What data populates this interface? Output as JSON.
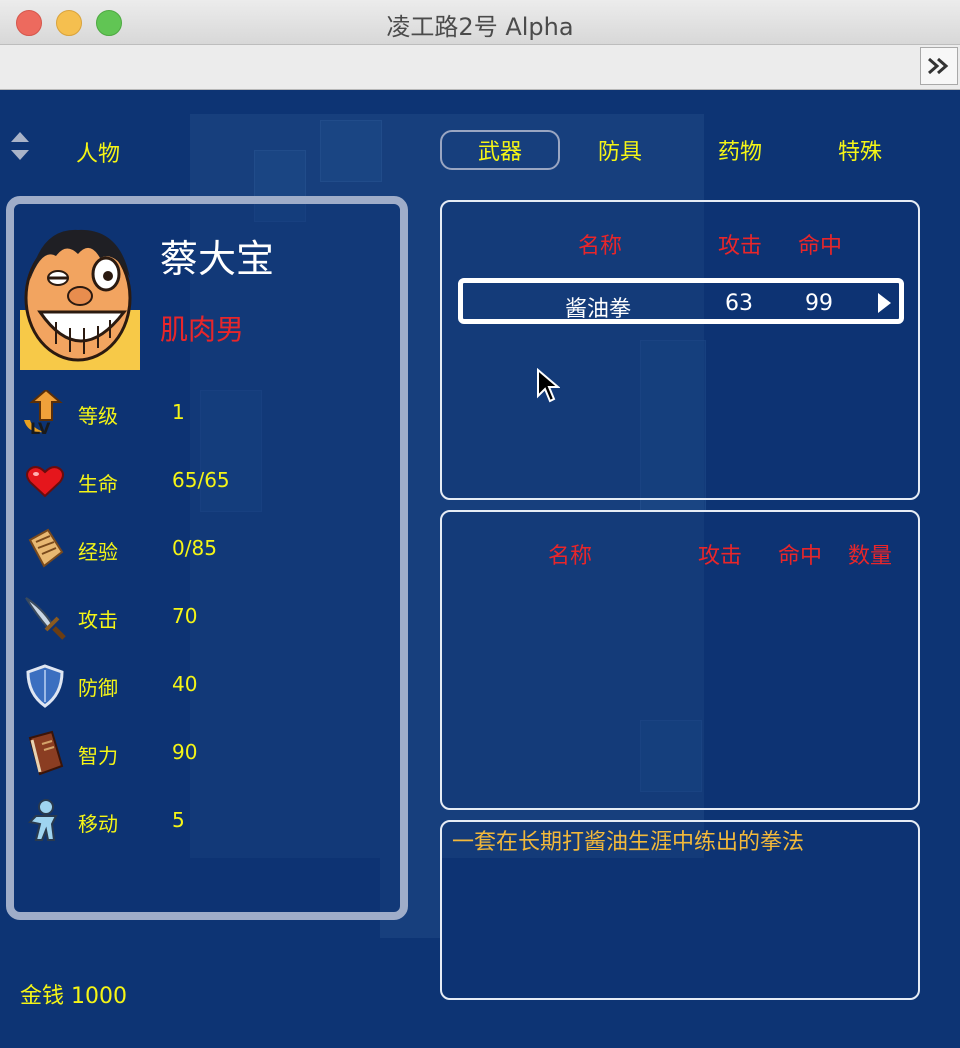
{
  "window": {
    "title": "凌工路2号 Alpha"
  },
  "sidebar": {
    "tab_label": "人物"
  },
  "tabs": [
    {
      "label": "武器",
      "active": true
    },
    {
      "label": "防具",
      "active": false
    },
    {
      "label": "药物",
      "active": false
    },
    {
      "label": "特殊",
      "active": false
    }
  ],
  "character": {
    "name": "蔡大宝",
    "class": "肌肉男",
    "stats": [
      {
        "icon": "level-up-icon",
        "label": "等级",
        "value": "1"
      },
      {
        "icon": "heart-icon",
        "label": "生命",
        "value": "65/65"
      },
      {
        "icon": "scroll-icon",
        "label": "经验",
        "value": "0/85"
      },
      {
        "icon": "sword-icon",
        "label": "攻击",
        "value": "70"
      },
      {
        "icon": "shield-icon",
        "label": "防御",
        "value": "40"
      },
      {
        "icon": "book-icon",
        "label": "智力",
        "value": "90"
      },
      {
        "icon": "walking-person-icon",
        "label": "移动",
        "value": "5"
      }
    ]
  },
  "money": "金钱 1000",
  "equipped": {
    "headers": {
      "name": "名称",
      "attack": "攻击",
      "hit": "命中"
    },
    "rows": [
      {
        "name": "酱油拳",
        "attack": "63",
        "hit": "99"
      }
    ]
  },
  "inventory": {
    "headers": {
      "name": "名称",
      "attack": "攻击",
      "hit": "命中",
      "count": "数量"
    },
    "rows": []
  },
  "description": "一套在长期打酱油生涯中练出的拳法",
  "colors": {
    "background": "#0d3474",
    "label_yellow": "#f5f516",
    "header_red": "#e8262a",
    "description_orange": "#f3b93a",
    "card_border": "#9fadc9"
  }
}
